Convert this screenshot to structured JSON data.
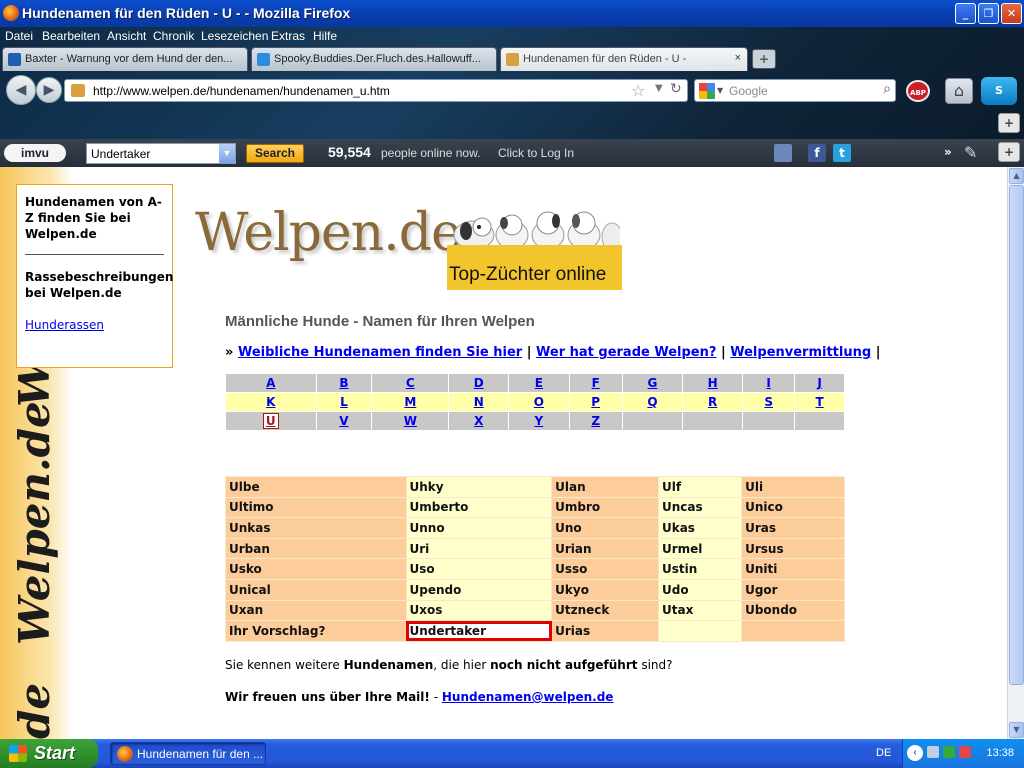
{
  "window": {
    "title": "Hundenamen für den Rüden - U - - Mozilla Firefox",
    "buttons": {
      "min": "_",
      "max": "❐",
      "close": "✕"
    }
  },
  "menu": [
    "Datei",
    "Bearbeiten",
    "Ansicht",
    "Chronik",
    "Lesezeichen",
    "Extras",
    "Hilfe"
  ],
  "tabs": [
    {
      "label": "Baxter - Warnung vor dem Hund der den...",
      "icon": "k-icon",
      "icon_color": "#1f5fb0"
    },
    {
      "label": "Spooky.Buddies.Der.Fluch.des.Hallowuff...",
      "icon": "cloud-icon",
      "icon_color": "#2a8ee0"
    },
    {
      "label": "Hundenamen für den Rüden - U -",
      "icon": "page-icon",
      "icon_color": "#d8a040",
      "active": true
    }
  ],
  "tab_close": "×",
  "new_tab": "+",
  "nav": {
    "url": "http://www.welpen.de/hundenamen/hundenamen_u.htm",
    "search_placeholder": "Google",
    "abp_label": "ABP",
    "skype_label": "S",
    "plus": "+"
  },
  "imvu": {
    "logo": "imvu",
    "input_value": "Undertaker",
    "search_label": "Search",
    "count": "59,554",
    "online_text": "people online now.",
    "login_text": "Click to Log In",
    "more": "»"
  },
  "page": {
    "band_words": [
      "W",
      "Welpen.de",
      "de"
    ],
    "sidebox": {
      "p1": "Hundenamen von A-Z finden Sie bei Welpen.de",
      "p2": "Rassebeschreibungen bei Welpen.de",
      "link": "Hunderassen"
    },
    "logo_text": "Welpen.de",
    "logo_tag": "Top-Züchter online",
    "heading": "Männliche Hunde - Namen für Ihren Welpen",
    "links_prefix": "»",
    "links": [
      "Weibliche Hundenamen finden Sie hier",
      "Wer hat gerade Welpen?",
      "Welpenvermittlung"
    ],
    "links_sep": "|",
    "alphabet": [
      [
        "A",
        "B",
        "C",
        "D",
        "E",
        "F",
        "G",
        "H",
        "I",
        "J"
      ],
      [
        "K",
        "L",
        "M",
        "N",
        "O",
        "P",
        "Q",
        "R",
        "S",
        "T"
      ],
      [
        "U",
        "V",
        "W",
        "X",
        "Y",
        "Z",
        "",
        "",
        "",
        ""
      ]
    ],
    "current_letter": "U",
    "names": [
      [
        "Ulbe",
        "Uhky",
        "Ulan",
        "Ulf",
        "Uli"
      ],
      [
        "Ultimo",
        "Umberto",
        "Umbro",
        "Uncas",
        "Unico"
      ],
      [
        "Unkas",
        "Unno",
        "Uno",
        "Ukas",
        "Uras"
      ],
      [
        "Urban",
        "Uri",
        "Urian",
        "Urmel",
        "Ursus"
      ],
      [
        "Usko",
        "Uso",
        "Usso",
        "Ustin",
        "Uniti"
      ],
      [
        "Unical",
        "Upendo",
        "Ukyo",
        "Udo",
        "Ugor"
      ],
      [
        "Uxan",
        "Uxos",
        "Utzneck",
        "Utax",
        "Ubondo"
      ],
      [
        "Ihr Vorschlag?",
        "Undertaker",
        "Urias",
        "",
        ""
      ]
    ],
    "info1_a": "Sie kennen weitere ",
    "info1_b": "Hundenamen",
    "info1_c": ", die hier ",
    "info1_d": "noch nicht aufgeführt",
    "info1_e": " sind?",
    "info2_text": "Wir freuen uns über Ihre Mail!",
    "info2_sep": " - ",
    "info2_link": "Hundenamen@welpen.de"
  },
  "scroll": {
    "up": "▲",
    "down": "▼"
  },
  "taskbar": {
    "start": "Start",
    "item": "Hundenamen für den ...",
    "lang": "DE",
    "tray_arrow": "‹",
    "clock": "13:38"
  }
}
